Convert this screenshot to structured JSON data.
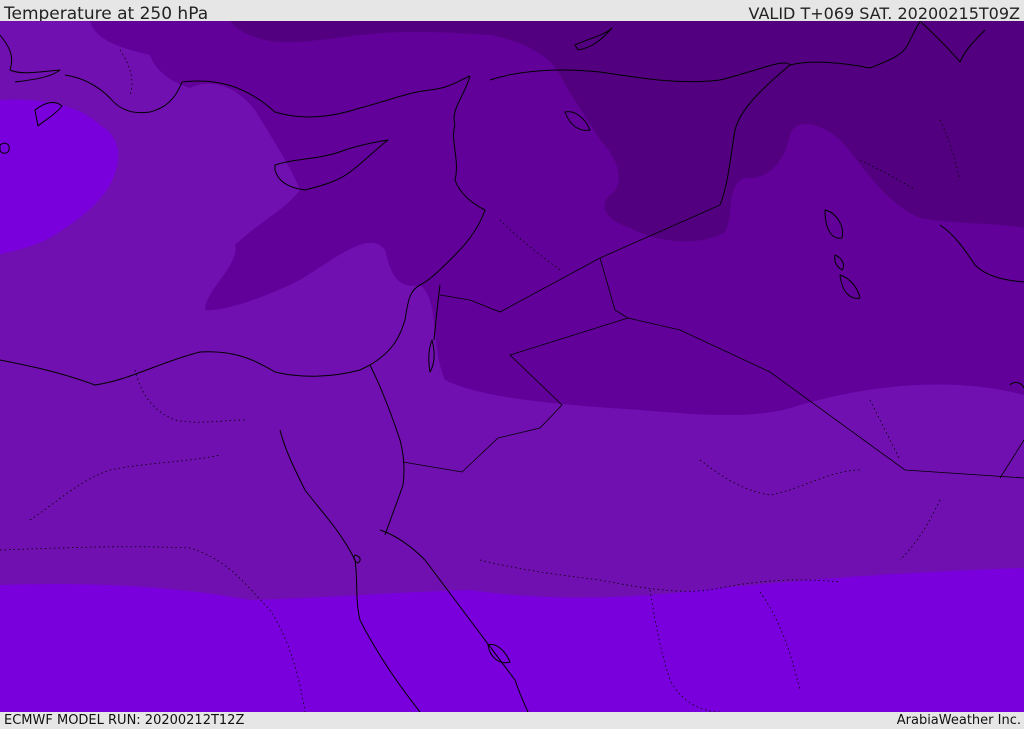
{
  "header": {
    "title": "Temperature at 250 hPa",
    "valid": "VALID T+069 SAT. 20200215T09Z"
  },
  "footer": {
    "model_run": "ECMWF MODEL RUN: 20200212T12Z",
    "credit": "ArabiaWeather Inc."
  },
  "colors": {
    "band_coldest": "#530080",
    "band_cold": "#62009a",
    "band_mid": "#7110b0",
    "band_warm": "#7900dc",
    "coastline": "#000000",
    "background_bar": "#e6e6e6"
  }
}
